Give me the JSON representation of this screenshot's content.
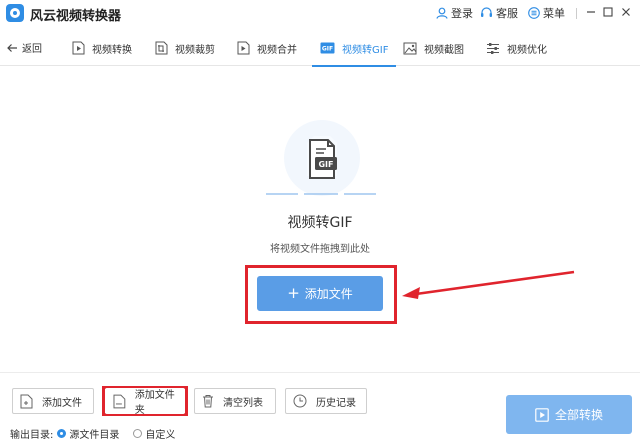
{
  "app": {
    "title": "风云视频转换器"
  },
  "titlebar": {
    "login": "登录",
    "service": "客服",
    "menu": "菜单"
  },
  "nav": {
    "back": "返回",
    "tabs": [
      {
        "label": "视频转换",
        "icon": "play-file-icon"
      },
      {
        "label": "视频裁剪",
        "icon": "crop-file-icon"
      },
      {
        "label": "视频合并",
        "icon": "merge-file-icon"
      },
      {
        "label": "视频转GIF",
        "icon": "gif-icon",
        "active": true
      },
      {
        "label": "视频截图",
        "icon": "screenshot-icon"
      },
      {
        "label": "视频优化",
        "icon": "sliders-icon"
      }
    ]
  },
  "dropzone": {
    "icon_badge": "GIF",
    "title": "视频转GIF",
    "hint": "将视频文件拖拽到此处",
    "add_file": "添加文件"
  },
  "toolbar": {
    "add_file": "添加文件",
    "add_folder": "添加文件夹",
    "clear_list": "清空列表",
    "history": "历史记录",
    "start_all": "全部转换"
  },
  "output": {
    "label": "输出目录:",
    "options": [
      {
        "label": "源文件目录",
        "selected": true
      },
      {
        "label": "自定义",
        "selected": false
      }
    ]
  },
  "colors": {
    "accent": "#2f8de4",
    "button": "#5a9de6",
    "highlight": "#e0242d"
  }
}
